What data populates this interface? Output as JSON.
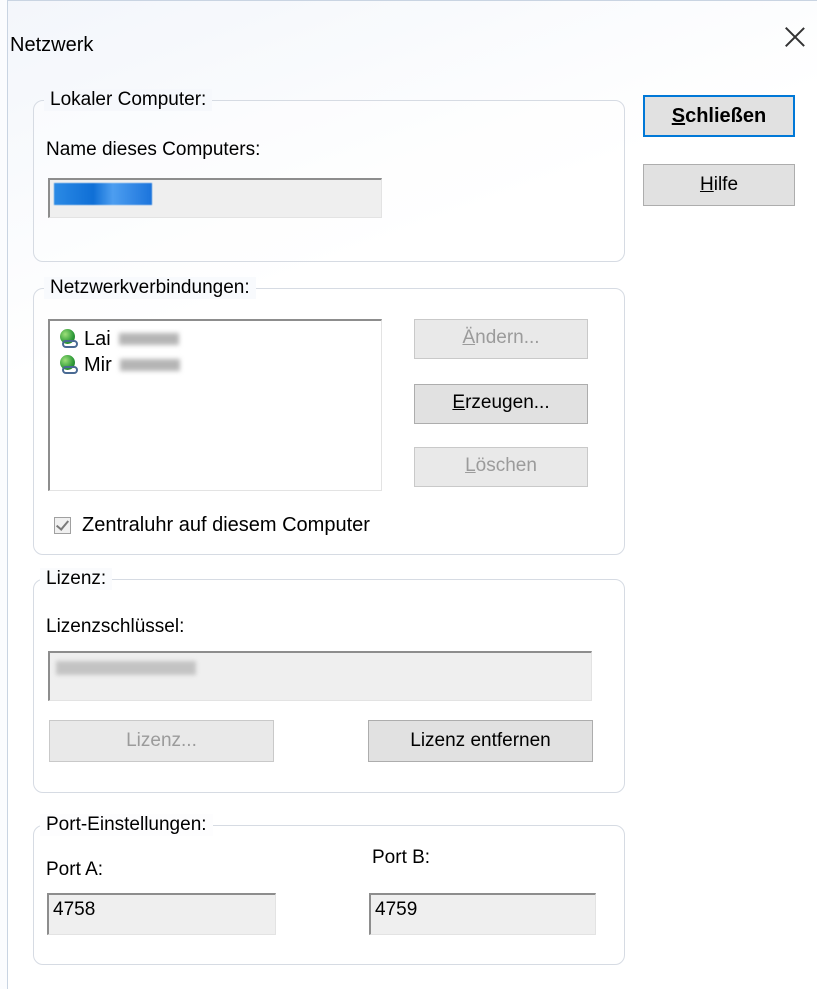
{
  "window": {
    "title": "Netzwerk",
    "close_icon": "close-icon"
  },
  "local_computer": {
    "legend": "Lokaler Computer:",
    "name_label": "Name dieses Computers:",
    "name_value": ""
  },
  "connections": {
    "legend": "Netzwerkverbindungen:",
    "items": [
      {
        "label": "Lai",
        "icon": "network-connection-icon"
      },
      {
        "label": "Mir",
        "icon": "network-connection-icon"
      }
    ],
    "buttons": {
      "change": {
        "label": "Ändern...",
        "mnemonic": "Ä",
        "rest": "ndern..."
      },
      "create": {
        "label": "Erzeugen...",
        "mnemonic": "E",
        "rest": "rzeugen..."
      },
      "delete": {
        "label": "Löschen",
        "mnemonic": "L",
        "rest": "öschen"
      }
    },
    "central_clock_checkbox": {
      "label": "Zentraluhr auf diesem Computer",
      "checked": true
    }
  },
  "license": {
    "legend": "Lizenz:",
    "key_label": "Lizenzschlüssel:",
    "key_value": "",
    "license_button": "Lizenz...",
    "remove_button": "Lizenz entfernen"
  },
  "ports": {
    "legend": "Port-Einstellungen:",
    "port_a_label": "Port A:",
    "port_a_value": "4758",
    "port_b_label": "Port B:",
    "port_b_value": "4759"
  },
  "actions": {
    "close": {
      "label": "Schließen",
      "mnemonic": "S",
      "rest": "chließen"
    },
    "help": {
      "label": "Hilfe",
      "mnemonic": "H",
      "rest": "ilfe"
    }
  },
  "colors": {
    "default_button_border": "#0078d7",
    "selection_blue": "#0f6fd6"
  }
}
